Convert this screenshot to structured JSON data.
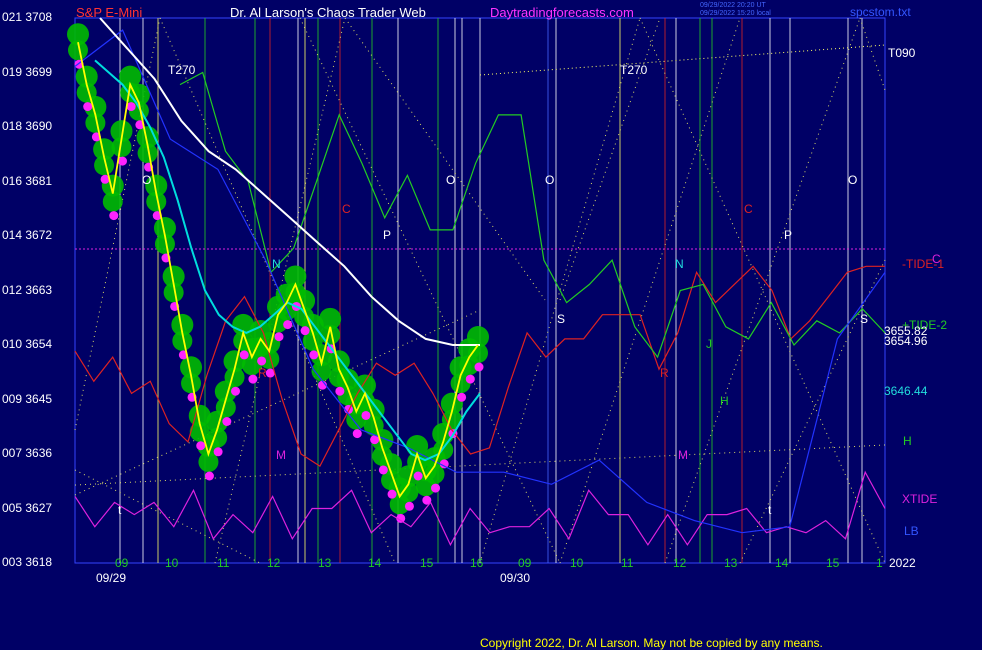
{
  "header": {
    "left_title": "S&P E-Mini",
    "center_title": "Dr. Al Larson's Chaos Trader Web",
    "site": "Daytradingforecasts.com",
    "stamp_line1": "09/29/2022 20:20 UT",
    "stamp_line2": "09/29/2022 15:20 local",
    "filename": "spcstom.txt",
    "copyright": "Copyright 2022, Dr. Al Larson. May not be copied by any means."
  },
  "colors": {
    "background": "#000066",
    "price_bands": "#00bb00",
    "price_line": "#ffff00",
    "ma_fast": "#00dddd",
    "ma_slow": "#ffffff",
    "tide1": "#dd2222",
    "tide2": "#22cc22",
    "xtide": "#dd22dd",
    "lb": "#2233ff",
    "magenta_dots": "#ff22ff"
  },
  "chart_data": {
    "type": "line",
    "y_axis": {
      "range": [
        3618,
        3708
      ],
      "ticks": [
        3708,
        3699,
        3690,
        3681,
        3672,
        3663,
        3654,
        3645,
        3636,
        3627,
        3618
      ],
      "prefixes": [
        "021",
        "019",
        "018",
        "016",
        "014",
        "012",
        "010",
        "009",
        "007",
        "005",
        "003"
      ]
    },
    "x_axis": {
      "hours": [
        "09",
        "10",
        "11",
        "12",
        "13",
        "14",
        "15",
        "16",
        "09",
        "10",
        "11",
        "12",
        "13",
        "14",
        "15",
        "1"
      ],
      "dates": [
        "09/29",
        "09/30"
      ],
      "year": "2022"
    },
    "series": [
      {
        "id": "price",
        "values": [
          3704,
          3697,
          3692,
          3685,
          3679,
          3688,
          3697,
          3694,
          3687,
          3679,
          3672,
          3664,
          3656,
          3649,
          3641,
          3636,
          3640,
          3645,
          3650,
          3656,
          3652,
          3655,
          3653,
          3659,
          3661,
          3664,
          3660,
          3656,
          3651,
          3657,
          3650,
          3647,
          3643,
          3646,
          3642,
          3637,
          3633,
          3629,
          3631,
          3636,
          3632,
          3634,
          3638,
          3643,
          3649,
          3652,
          3654
        ]
      },
      {
        "id": "ma-fast",
        "values": [
          3701,
          3699,
          3697,
          3694,
          3690,
          3685,
          3678,
          3670,
          3663,
          3659,
          3657,
          3656,
          3657,
          3659,
          3661,
          3660,
          3657,
          3654,
          3651,
          3648,
          3645,
          3642,
          3639,
          3636,
          3635,
          3636,
          3639,
          3643,
          3646
        ]
      },
      {
        "id": "ma-slow",
        "values": [
          3708,
          3703,
          3698,
          3691,
          3686,
          3683,
          3679,
          3675,
          3671,
          3667,
          3662,
          3658,
          3655,
          3654,
          3654
        ]
      },
      {
        "id": "tide1",
        "values": [
          3653,
          3648,
          3652,
          3646,
          3648,
          3641,
          3638,
          3649,
          3658,
          3662,
          3656,
          3645,
          3636,
          3634,
          3640,
          3646,
          3651,
          3649,
          3651,
          3646,
          3640,
          3636,
          3637,
          3647,
          3656,
          3652,
          3655,
          3655,
          3659,
          3659,
          3659,
          3650,
          3656,
          3666,
          3661,
          3664,
          3667,
          3663,
          3655,
          3658,
          3662,
          3666,
          3667,
          3667
        ]
      },
      {
        "id": "tide2",
        "values": [
          3697,
          3699,
          3686,
          3681,
          3666,
          3670,
          3681,
          3692,
          3684,
          3675,
          3682,
          3673,
          3673,
          3684,
          3692,
          3692,
          3668,
          3661,
          3664,
          3668,
          3657,
          3652,
          3663,
          3664,
          3657,
          3655,
          3661,
          3654,
          3658,
          3656,
          3660,
          3656
        ]
      },
      {
        "id": "xtide",
        "values": [
          3629,
          3624,
          3628,
          3626,
          3628,
          3624,
          3630,
          3622,
          3626,
          3623,
          3629,
          3622,
          3627,
          3627,
          3630,
          3623,
          3626,
          3624,
          3628,
          3621,
          3627,
          3623,
          3624,
          3624,
          3627,
          3622,
          3630,
          3626,
          3626,
          3621,
          3626,
          3621,
          3626,
          3626,
          3627,
          3623,
          3624,
          3623,
          3625,
          3622,
          3633,
          3627
        ]
      },
      {
        "id": "lb",
        "values": [
          3700,
          3706,
          3688,
          3683,
          3668,
          3650,
          3640,
          3637,
          3633,
          3633,
          3631,
          3635,
          3628,
          3625,
          3623,
          3624,
          3655,
          3666
        ]
      }
    ],
    "right_labels": [
      {
        "text": "T090",
        "value": 3703
      },
      {
        "text": "C",
        "value": 3669
      },
      {
        "text": "-TIDE-1",
        "value": 3667
      },
      {
        "text": "+TIDE-2",
        "value": 3656
      },
      {
        "text": "3655.82",
        "value": 3656
      },
      {
        "text": "3654.96",
        "value": 3654
      },
      {
        "text": "3646.44",
        "value": 3646
      },
      {
        "text": "H",
        "value": 3638
      },
      {
        "text": "XTIDE",
        "value": 3628
      },
      {
        "text": "LB",
        "value": 3623
      }
    ],
    "markers": [
      {
        "text": "T270",
        "series": "yellow"
      },
      {
        "text": "T270",
        "series": "yellow"
      },
      {
        "text": "O",
        "series": "white"
      },
      {
        "text": "O",
        "series": "white"
      },
      {
        "text": "O",
        "series": "white"
      },
      {
        "text": "O",
        "series": "white"
      },
      {
        "text": "P",
        "series": "white"
      },
      {
        "text": "P",
        "series": "white"
      },
      {
        "text": "N",
        "series": "cyan"
      },
      {
        "text": "N",
        "series": "cyan"
      },
      {
        "text": "S",
        "series": "white"
      },
      {
        "text": "S",
        "series": "white"
      },
      {
        "text": "R",
        "series": "red"
      },
      {
        "text": "R",
        "series": "red"
      },
      {
        "text": "C",
        "series": "red"
      },
      {
        "text": "C",
        "series": "red"
      },
      {
        "text": "M",
        "series": "magenta"
      },
      {
        "text": "M",
        "series": "magenta"
      },
      {
        "text": "H",
        "series": "green"
      },
      {
        "text": "J",
        "series": "green"
      },
      {
        "text": "t",
        "series": "white"
      },
      {
        "text": "t",
        "series": "white"
      }
    ]
  }
}
